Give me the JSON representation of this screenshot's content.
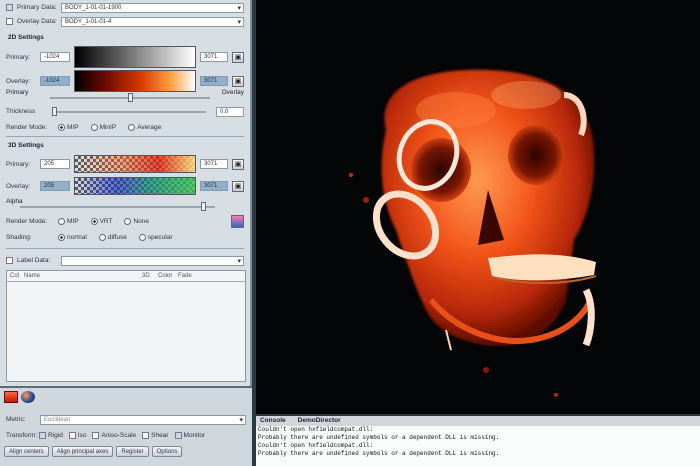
{
  "panel": {
    "primary_data_label": "Primary Data:",
    "primary_data_value": "BODY_1-01-01-1900",
    "overlay_data_label": "Overlay Data:",
    "overlay_data_value": "BODY_1-01-01-4",
    "settings_2d": {
      "title": "2D Settings",
      "primary_label": "Primary:",
      "primary_min": "-1024",
      "primary_max": "3071",
      "overlay_label": "Overlay:",
      "overlay_min": "-1024",
      "overlay_max": "3071",
      "blend_left": "Primary",
      "blend_right": "Overlay",
      "blend_level": 0.5,
      "thickness_label": "Thickness",
      "thickness_value": "0.0",
      "render_mode_label": "Render Mode:",
      "render_modes": [
        "MIP",
        "MinIP",
        "Average"
      ],
      "render_mode_selected": "MIP"
    },
    "settings_3d": {
      "title": "3D Settings",
      "primary_label": "Primary:",
      "primary_min": "205",
      "primary_max": "3071",
      "overlay_label": "Overlay:",
      "overlay_min": "205",
      "overlay_max": "3071",
      "alpha_label": "Alpha",
      "alpha_level": 0.95,
      "render_mode_label": "Render Mode:",
      "render_modes": [
        "MIP",
        "VRT",
        "None"
      ],
      "render_mode_selected": "VRT",
      "shading_label": "Shading:",
      "shading_modes": [
        "normal",
        "diffuse",
        "specular"
      ],
      "shading_selected": "normal"
    },
    "label_data_label": "Label Data:",
    "label_columns": [
      "Col",
      "Name",
      "3D",
      "Color",
      "Fade"
    ],
    "metric_label": "Metric:",
    "metric_value": "Euclidean",
    "transform_label": "Transform:",
    "transform_options": [
      {
        "label": "Rigid",
        "checked": true
      },
      {
        "label": "Iso",
        "checked": false
      },
      {
        "label": "Aniso-Scale",
        "checked": false
      },
      {
        "label": "Shear",
        "checked": false
      },
      {
        "label": "Monitor",
        "checked": true
      }
    ],
    "buttons": [
      "Align centers",
      "Align principal axes",
      "Register",
      "Options"
    ]
  },
  "console": {
    "tabs": [
      "Console",
      "DemoDirector"
    ],
    "lines": [
      "Couldn't open hxfieldcompat.dll:",
      "Probably there are undefined symbols or a dependent DLL is missing.",
      "Couldn't open hxfieldcompat.dll:",
      "Probably there are undefined symbols or a dependent DLL is missing."
    ]
  },
  "colors": {
    "bone": "#f25a1a",
    "highlight": "#ffd0a0",
    "background": "#040507"
  }
}
